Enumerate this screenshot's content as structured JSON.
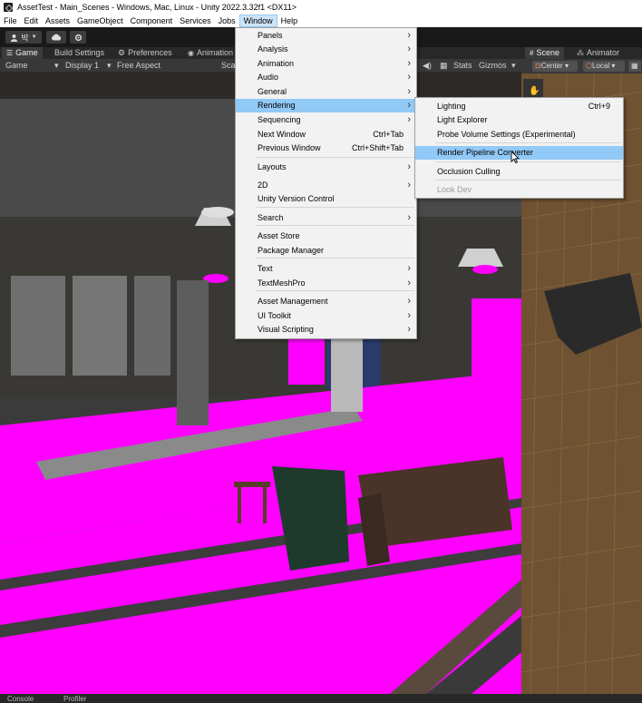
{
  "window": {
    "title": "AssetTest - Main_Scenes - Windows, Mac, Linux - Unity 2022.3.32f1 <DX11>"
  },
  "menubar": [
    "File",
    "Edit",
    "Assets",
    "GameObject",
    "Component",
    "Services",
    "Jobs",
    "Window",
    "Help"
  ],
  "toolbar": {
    "account_label": "박",
    "cloud_icon": "cloud-icon",
    "settings_icon": "gear-icon"
  },
  "game_tabs": [
    "Game",
    "Build Settings",
    "Preferences",
    "Animation"
  ],
  "game_bar": {
    "mode": "Game",
    "display": "Display 1",
    "aspect": "Free Aspect",
    "scale_label": "Sca",
    "stats": "Stats",
    "gizmos": "Gizmos"
  },
  "scene_tabs": [
    "Scene",
    "Animator"
  ],
  "scene_bar": {
    "pivot": "Center",
    "space": "Local"
  },
  "window_menu": [
    {
      "label": "Panels",
      "sub": true
    },
    {
      "label": "Analysis",
      "sub": true
    },
    {
      "label": "Animation",
      "sub": true
    },
    {
      "label": "Audio",
      "sub": true
    },
    {
      "label": "General",
      "sub": true
    },
    {
      "label": "Rendering",
      "sub": true,
      "highlight": true
    },
    {
      "label": "Sequencing",
      "sub": true
    },
    {
      "label": "Next Window",
      "shortcut": "Ctrl+Tab"
    },
    {
      "label": "Previous Window",
      "shortcut": "Ctrl+Shift+Tab"
    },
    {
      "label": "Layouts",
      "sub": true
    },
    {
      "label": "2D",
      "sub": true
    },
    {
      "label": "Unity Version Control"
    },
    {
      "label": "Search",
      "sub": true
    },
    {
      "label": "Asset Store"
    },
    {
      "label": "Package Manager"
    },
    {
      "label": "Text",
      "sub": true
    },
    {
      "label": "TextMeshPro",
      "sub": true
    },
    {
      "label": "Asset Management",
      "sub": true
    },
    {
      "label": "UI Toolkit",
      "sub": true
    },
    {
      "label": "Visual Scripting",
      "sub": true
    }
  ],
  "rendering_menu": [
    {
      "label": "Lighting",
      "shortcut": "Ctrl+9"
    },
    {
      "label": "Light Explorer"
    },
    {
      "label": "Probe Volume Settings (Experimental)"
    },
    {
      "label": "Render Pipeline Converter",
      "highlight": true
    },
    {
      "label": "Occlusion Culling"
    },
    {
      "label": "Look Dev",
      "disabled": true
    }
  ],
  "bottom_tabs": [
    "Console",
    "Profiler"
  ],
  "colors": {
    "missing_material": "#ff00ff",
    "menu_highlight": "#91c9f7",
    "editor_dark": "#282828"
  }
}
